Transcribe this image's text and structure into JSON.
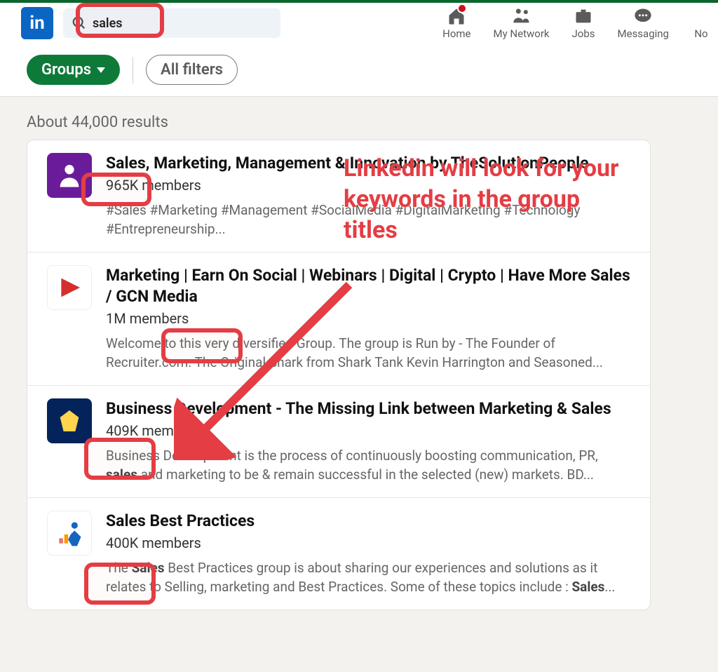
{
  "header": {
    "search_value": "sales",
    "nav": [
      {
        "label": "Home"
      },
      {
        "label": "My Network"
      },
      {
        "label": "Jobs"
      },
      {
        "label": "Messaging"
      },
      {
        "label": "No"
      }
    ]
  },
  "filters": {
    "active": "Groups",
    "all": "All filters"
  },
  "result_count": "About 44,000 results",
  "results": [
    {
      "title": "Sales, Marketing, Management & Innovation by TheSolutionPeople",
      "members": "965K members",
      "description": "#Sales #Marketing #Management #SocialMedia #DigitalMarketing #Technology #Entrepreneurship..."
    },
    {
      "title": "Marketing | Earn On Social | Webinars | Digital | Crypto | Have More Sales / GCN Media",
      "members": "1M members",
      "description_pre": "Welcome to this very diversified Group. The group is Run by - The Founder of Recruiter.com. The Original Shark from Shark Tank Kevin Harrington and Seasoned..."
    },
    {
      "title": "Business Development - The Missing Link between Marketing & Sales",
      "members": "409K members",
      "description_pre": "Business Development is the process of continuously boosting communication, PR, ",
      "description_bold": "sales",
      "description_post": " and marketing to be & remain successful in the selected (new) markets. BD..."
    },
    {
      "title": "Sales Best Practices",
      "members": "400K members",
      "description_pre": "The ",
      "description_bold": "Sales",
      "description_mid": " Best Practices group is about sharing our experiences and solutions as it relates to Selling, marketing and Best Practices. Some of these topics include : ",
      "description_bold2": "Sales",
      "description_post": "..."
    }
  ],
  "annotation": "Linkedin will look for your keywords in the group titles"
}
